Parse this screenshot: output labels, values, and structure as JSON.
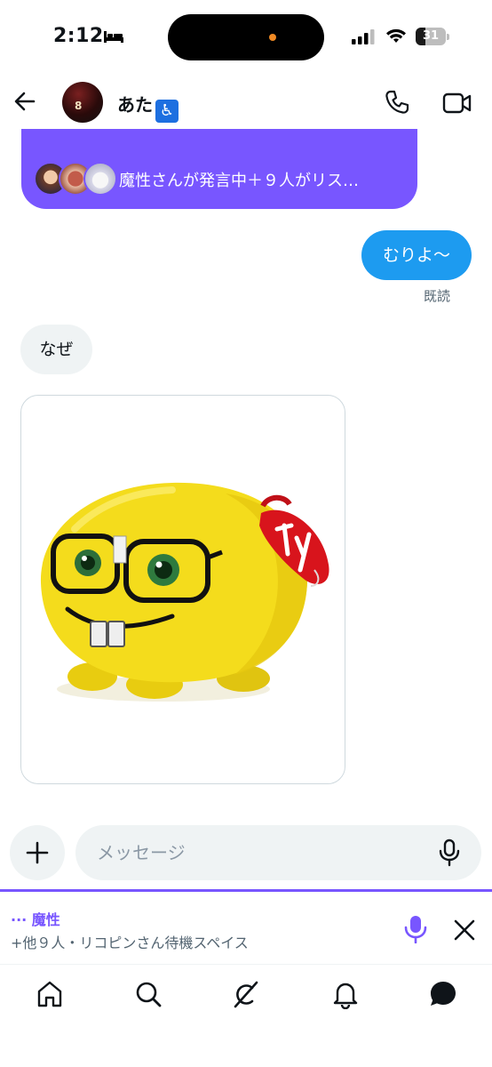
{
  "status_bar": {
    "time": "2:12",
    "battery_level": "31",
    "battery_fraction": 0.31
  },
  "header": {
    "name": "あた",
    "name_badge": "♿",
    "avatar_text": "8"
  },
  "space_banner": {
    "text": "魔性さんが発言中＋９人がリス…"
  },
  "messages": [
    {
      "direction": "sent",
      "text": "むりよ〜",
      "status": "既読"
    },
    {
      "direction": "received",
      "text": "なぜ"
    },
    {
      "direction": "received",
      "type": "image",
      "image_icon": "plush-toy-nerd-emoji"
    }
  ],
  "composer": {
    "placeholder": "メッセージ"
  },
  "mini_space": {
    "title": "··· 魔性",
    "subtitle": "+他９人・リコピンさん待機スペイス"
  },
  "tabs": [
    {
      "icon": "home-icon"
    },
    {
      "icon": "search-icon"
    },
    {
      "icon": "grok-icon"
    },
    {
      "icon": "bell-icon"
    },
    {
      "icon": "messages-icon",
      "active": true
    }
  ],
  "colors": {
    "space_purple": "#7856ff",
    "sent_bubble": "#1d9bf0",
    "received_bubble": "#eff3f4",
    "muted_text": "#536471"
  }
}
